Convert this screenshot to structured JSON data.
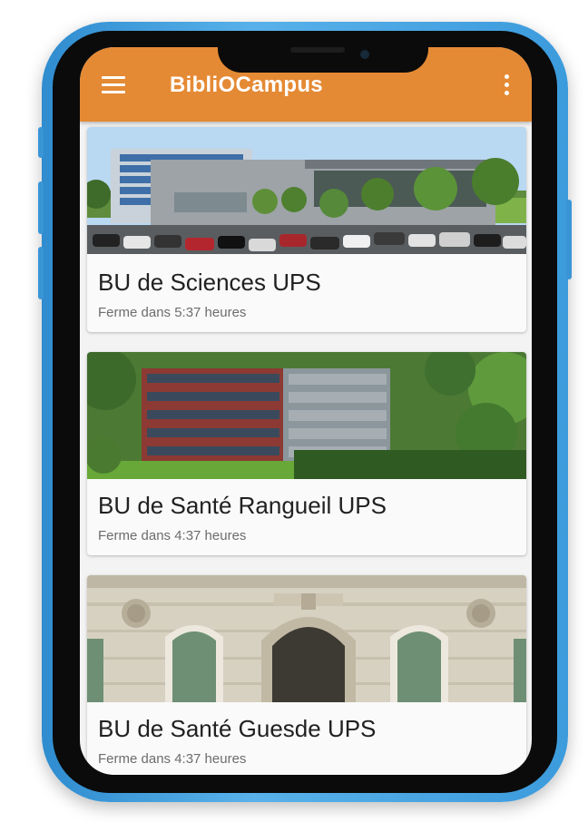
{
  "app": {
    "title": "BibliOCampus"
  },
  "icons": {
    "menu": "hamburger-menu-icon",
    "more": "more-vert-icon"
  },
  "colors": {
    "appbar": "#e58a34",
    "phone_frame": "#3c9bdc"
  },
  "libraries": [
    {
      "name": "BU de Sciences UPS",
      "status": "Ferme dans 5:37 heures"
    },
    {
      "name": "BU de Santé Rangueil UPS",
      "status": "Ferme dans 4:37 heures"
    },
    {
      "name": "BU de Santé Guesde UPS",
      "status": "Ferme dans 4:37 heures"
    }
  ]
}
